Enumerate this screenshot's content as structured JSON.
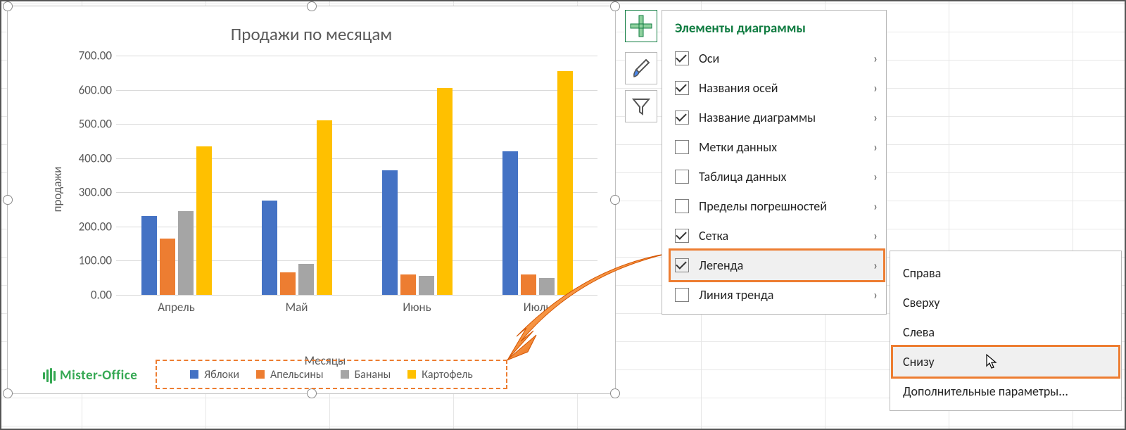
{
  "chart_title": "Продажи по месяцам",
  "y_axis_label": "продажи",
  "x_axis_label": "Месяцы",
  "y_ticks": [
    "0.00",
    "100.00",
    "200.00",
    "300.00",
    "400.00",
    "500.00",
    "600.00",
    "700.00"
  ],
  "watermark": "Mister-Office",
  "legend": [
    {
      "label": "Яблоки",
      "color": "#4472c4"
    },
    {
      "label": "Апельсины",
      "color": "#ed7d31"
    },
    {
      "label": "Бананы",
      "color": "#a5a5a5"
    },
    {
      "label": "Картофель",
      "color": "#ffc000"
    }
  ],
  "chart_data": {
    "type": "bar",
    "title": "Продажи по месяцам",
    "xlabel": "Месяцы",
    "ylabel": "продажи",
    "ylim": [
      0,
      700
    ],
    "categories": [
      "Апрель",
      "Май",
      "Июнь",
      "Июль"
    ],
    "series": [
      {
        "name": "Яблоки",
        "color": "#4472c4",
        "values": [
          230,
          275,
          365,
          420
        ]
      },
      {
        "name": "Апельсины",
        "color": "#ed7d31",
        "values": [
          165,
          65,
          60,
          60
        ]
      },
      {
        "name": "Бананы",
        "color": "#a5a5a5",
        "values": [
          245,
          90,
          55,
          50
        ]
      },
      {
        "name": "Картофель",
        "color": "#ffc000",
        "values": [
          435,
          510,
          605,
          655
        ]
      }
    ]
  },
  "side_buttons": {
    "plus": "chart-elements-button",
    "brush": "chart-styles-button",
    "filter": "chart-filters-button"
  },
  "flyout": {
    "title": "Элементы диаграммы",
    "items": [
      {
        "label": "Оси",
        "checked": true,
        "has_sub": true
      },
      {
        "label": "Названия осей",
        "checked": true,
        "has_sub": true
      },
      {
        "label": "Название диаграммы",
        "checked": true,
        "has_sub": true
      },
      {
        "label": "Метки данных",
        "checked": false,
        "has_sub": true
      },
      {
        "label": "Таблица данных",
        "checked": false,
        "has_sub": true
      },
      {
        "label": "Пределы погрешностей",
        "checked": false,
        "has_sub": true
      },
      {
        "label": "Сетка",
        "checked": true,
        "has_sub": true
      },
      {
        "label": "Легенда",
        "checked": true,
        "has_sub": true,
        "selected": true
      },
      {
        "label": "Линия тренда",
        "checked": false,
        "has_sub": true
      }
    ]
  },
  "subflyout": {
    "items": [
      {
        "label": "Справа"
      },
      {
        "label": "Сверху"
      },
      {
        "label": "Слева"
      },
      {
        "label": "Снизу",
        "selected": true
      },
      {
        "label": "Дополнительные параметры..."
      }
    ]
  }
}
